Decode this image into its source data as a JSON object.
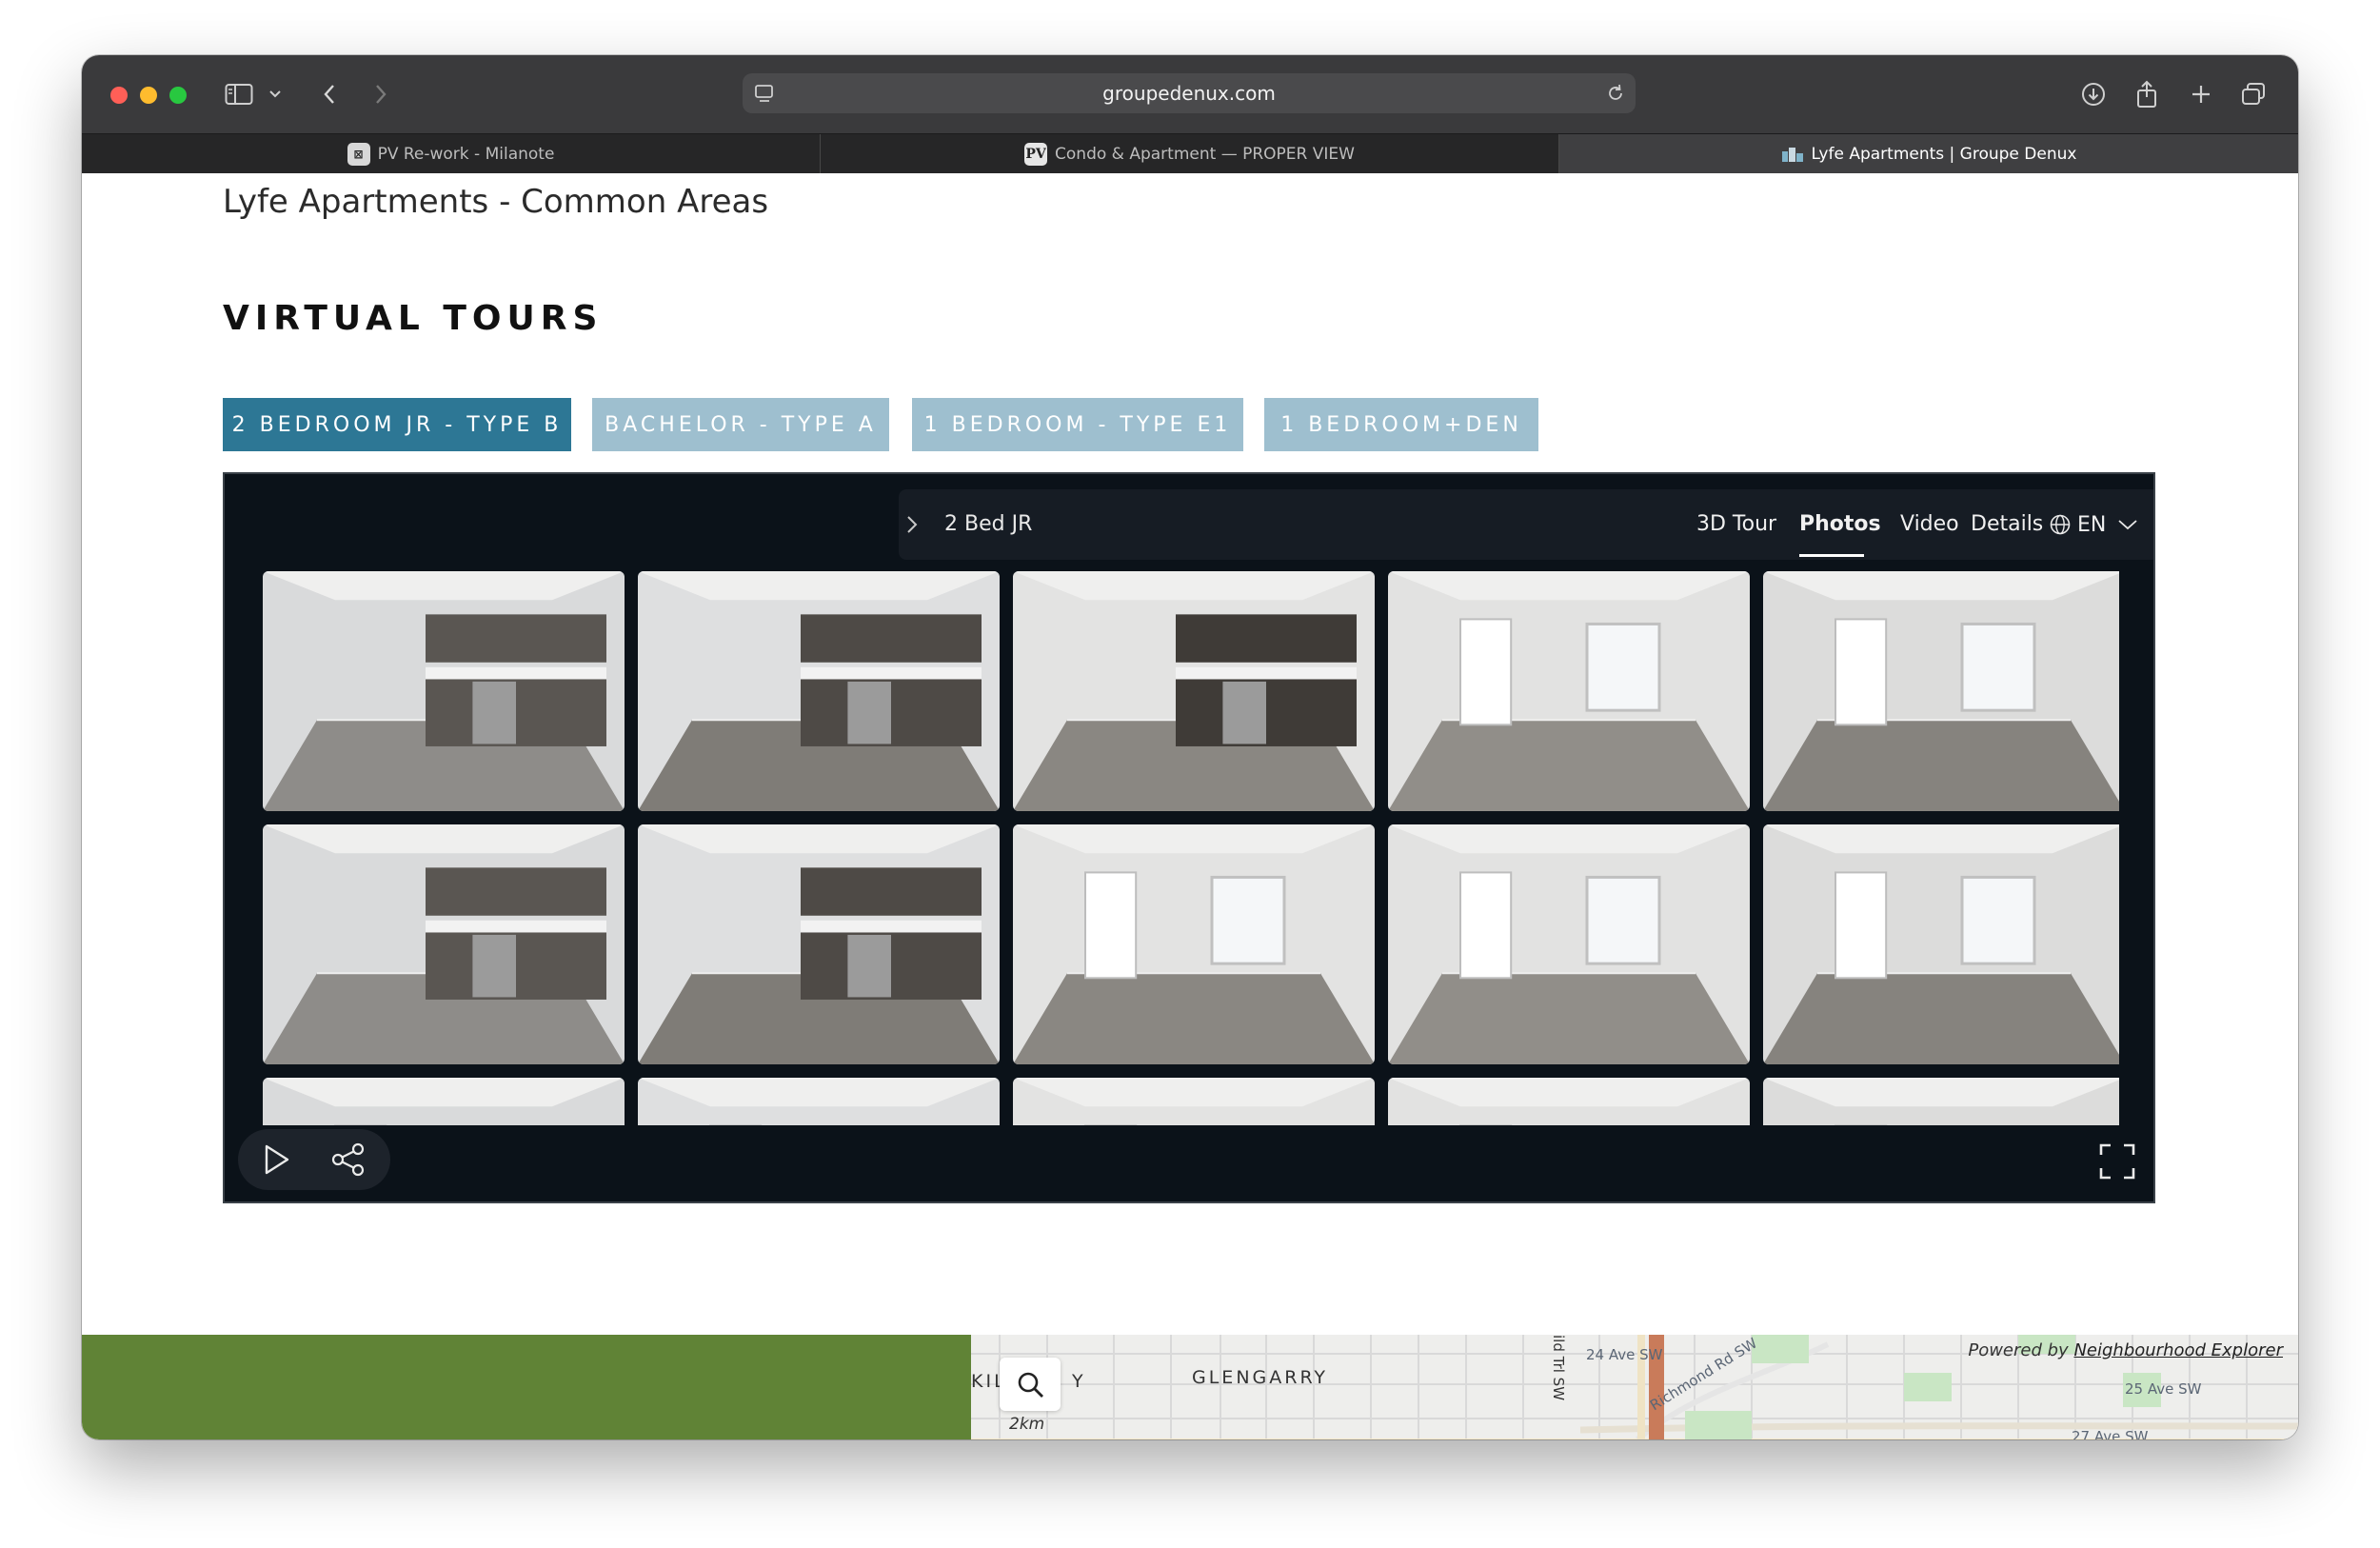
{
  "browser": {
    "url": "groupedenux.com",
    "tabs": [
      {
        "label": "PV Re-work - Milanote",
        "favicon": "milanote-icon"
      },
      {
        "label": "Condo & Apartment — PROPER VIEW",
        "favicon": "proper-view-icon",
        "favicon_text": "PV"
      },
      {
        "label": "Lyfe Apartments | Groupe Denux",
        "favicon": "groupe-denux-icon",
        "active": true
      }
    ]
  },
  "page": {
    "heading": "Lyfe Apartments - Common Areas",
    "section_title": "VIRTUAL TOURS",
    "tour_tabs": [
      {
        "label": "2 BEDROOM JR - TYPE B",
        "active": true
      },
      {
        "label": "BACHELOR - TYPE A",
        "active": false
      },
      {
        "label": "1 BEDROOM - TYPE E1",
        "active": false
      },
      {
        "label": "1 BEDROOM+DEN",
        "active": false
      }
    ]
  },
  "viewer": {
    "title": "2 Bed JR",
    "nav": [
      "3D Tour",
      "Photos",
      "Video",
      "Details"
    ],
    "active_nav": "Photos",
    "language": "EN",
    "photos_visible_rows": 3,
    "photos_per_row": 5
  },
  "map": {
    "area_labels": [
      "GLENGARRY",
      "KIL",
      "Y"
    ],
    "street_labels": [
      "24 Ave SW",
      "Richmond Rd SW",
      "25 Ave SW",
      "27 Ave SW",
      "ild Trl SW"
    ],
    "scale": "2km",
    "powered_by_prefix": "Powered by",
    "powered_by_link": "Neighbourhood Explorer"
  },
  "colors": {
    "tab_active": "#2d7795",
    "tab_inactive": "#9ebfcf",
    "viewer_bg": "#0b1219",
    "green_block": "#608336"
  }
}
